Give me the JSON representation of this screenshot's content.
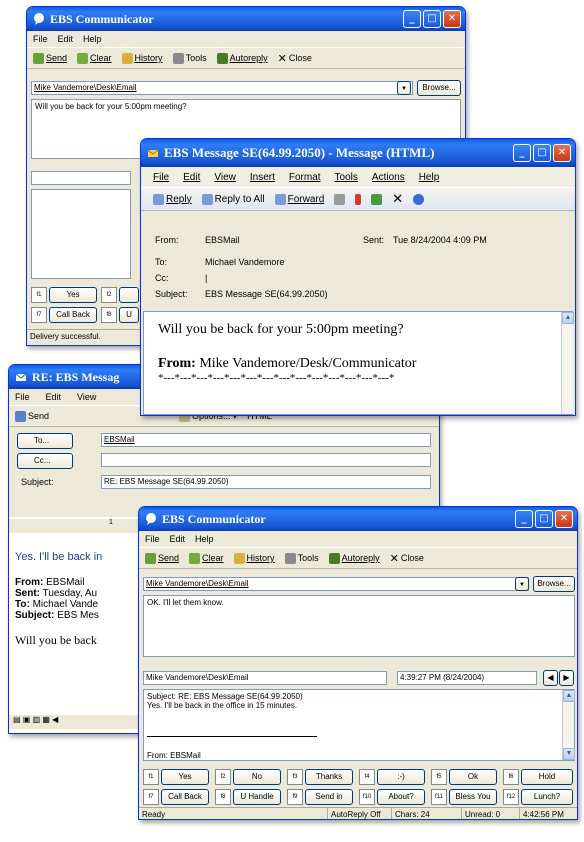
{
  "colors": {
    "title_blue": "#1957d6",
    "xp_face": "#ece9d8",
    "link_blue": "#0000ff"
  },
  "w1": {
    "title": "EBS Communicator",
    "menu": [
      "File",
      "Edit",
      "Help"
    ],
    "toolbar": [
      "Send",
      "Clear",
      "History",
      "Tools",
      "Autoreply",
      "Close"
    ],
    "to_value": "Mike Vandemore\\Desk\\Email",
    "browse": "Browse...",
    "message": "Will you be back for your 5:00pm meeting?",
    "fkeys": [
      {
        "k": "f1",
        "label": "Yes"
      },
      {
        "k": "f2",
        "label": ""
      }
    ],
    "fkeys2": [
      {
        "k": "f7",
        "label": "Call Back"
      },
      {
        "k": "f8",
        "label": "U"
      }
    ],
    "status": "Delivery successful."
  },
  "w2": {
    "title": "EBS Message SE(64.99.2050)  - Message (HTML)",
    "menu": [
      "File",
      "Edit",
      "View",
      "Insert",
      "Format",
      "Tools",
      "Actions",
      "Help"
    ],
    "toolbar": [
      "Reply",
      "Reply to All",
      "Forward"
    ],
    "from_label": "From:",
    "from": "EBSMail",
    "sent_label": "Sent:",
    "sent": "Tue 8/24/2004 4:09 PM",
    "to_label": "To:",
    "to": "Michael Vandemore",
    "cc_label": "Cc:",
    "cc": "|",
    "subject_label": "Subject:",
    "subject": "EBS Message SE(64.99.2050)",
    "body": "Will you be back for your 5:00pm meeting?",
    "from_line_label": "From:",
    "from_line": "Mike Vandemore/Desk/Communicator",
    "separator": "*---*---*---*---*---*---*---*---*---*---*---*---*---*---*"
  },
  "w3": {
    "title": "RE: EBS Messag",
    "menu": [
      "File",
      "Edit",
      "View"
    ],
    "toolbar_send": "Send",
    "options": "Options...",
    "html": "HTML",
    "to_btn": "To...",
    "to_value": "EBSMail",
    "cc_btn": "Cc...",
    "subject_label": "Subject:",
    "subject": "RE: EBS Message SE(64.99.2050)",
    "ruler": "1",
    "body": "Yes.  I'll be back in",
    "from_label": "From:",
    "from": "EBSMail",
    "sent_label": "Sent:",
    "sent": "Tuesday, Au",
    "to_label": "To:",
    "to": "Michael Vande",
    "subj_label": "Subject:",
    "subj": "EBS Mes",
    "quote": "Will you be back"
  },
  "w4": {
    "title": "EBS Communicator",
    "menu": [
      "File",
      "Edit",
      "Help"
    ],
    "toolbar": [
      "Send",
      "Clear",
      "History",
      "Tools",
      "Autoreply",
      "Close"
    ],
    "to_value": "Mike Vandemore\\Desk\\Email",
    "browse": "Browse...",
    "compose": "OK.  I'll let them know.",
    "history_from": "Mike Vandemore\\Desk\\Email",
    "history_time": "4:39:27 PM (8/24/2004)",
    "history_lines": [
      "Subject: RE: EBS Message SE(64.99.2050)",
      "Yes.  I'll be back in the office in 15 minutes."
    ],
    "history_from_line": "From: EBSMail",
    "row1": [
      {
        "k": "f1",
        "label": "Yes"
      },
      {
        "k": "f2",
        "label": "No"
      },
      {
        "k": "f3",
        "label": "Thanks"
      },
      {
        "k": "f4",
        "label": ":-)"
      },
      {
        "k": "f5",
        "label": "Ok"
      },
      {
        "k": "f6",
        "label": "Hold"
      }
    ],
    "row2": [
      {
        "k": "f7",
        "label": "Call Back"
      },
      {
        "k": "f8",
        "label": "U Handle"
      },
      {
        "k": "f9",
        "label": "Send in"
      },
      {
        "k": "f10",
        "label": "About?"
      },
      {
        "k": "f11",
        "label": "Bless You"
      },
      {
        "k": "f12",
        "label": "Lunch?"
      }
    ],
    "status": {
      "ready": "Ready",
      "autoreply": "AutoReply Off",
      "chars": "Chars: 24",
      "unread": "Unread: 0",
      "time": "4:42:56 PM"
    }
  }
}
